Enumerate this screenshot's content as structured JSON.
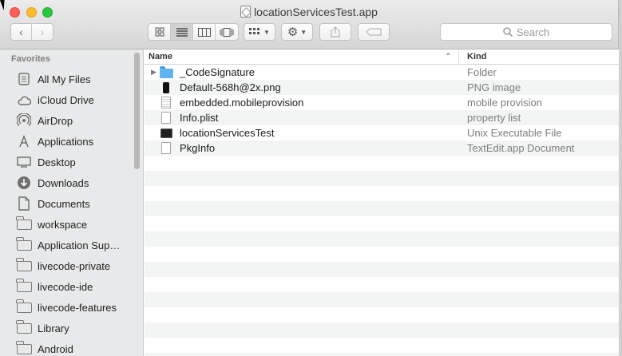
{
  "window": {
    "title": "locationServicesTest.app"
  },
  "toolbar": {
    "search_placeholder": "Search",
    "view_modes": [
      "icon",
      "list",
      "column",
      "cover-flow"
    ],
    "active_view": "list"
  },
  "sidebar": {
    "section_title": "Favorites",
    "items": [
      {
        "label": "All My Files",
        "icon": "all-files-icon"
      },
      {
        "label": "iCloud Drive",
        "icon": "cloud-icon"
      },
      {
        "label": "AirDrop",
        "icon": "airdrop-icon"
      },
      {
        "label": "Applications",
        "icon": "applications-icon"
      },
      {
        "label": "Desktop",
        "icon": "desktop-icon"
      },
      {
        "label": "Downloads",
        "icon": "downloads-icon"
      },
      {
        "label": "Documents",
        "icon": "documents-icon"
      },
      {
        "label": "workspace",
        "icon": "folder-icon"
      },
      {
        "label": "Application Sup…",
        "icon": "folder-icon"
      },
      {
        "label": "livecode-private",
        "icon": "folder-icon"
      },
      {
        "label": "livecode-ide",
        "icon": "folder-icon"
      },
      {
        "label": "livecode-features",
        "icon": "folder-icon"
      },
      {
        "label": "Library",
        "icon": "folder-icon"
      },
      {
        "label": "Android",
        "icon": "folder-icon"
      }
    ]
  },
  "file_list": {
    "columns": {
      "name": "Name",
      "kind": "Kind"
    },
    "rows": [
      {
        "name": "_CodeSignature",
        "kind": "Folder",
        "icon": "folder-icon",
        "expandable": true
      },
      {
        "name": "Default-568h@2x.png",
        "kind": "PNG image",
        "icon": "png-image-icon"
      },
      {
        "name": "embedded.mobileprovision",
        "kind": "mobile provision",
        "icon": "provision-file-icon"
      },
      {
        "name": "Info.plist",
        "kind": "property list",
        "icon": "plist-file-icon"
      },
      {
        "name": "locationServicesTest",
        "kind": "Unix Executable File",
        "icon": "executable-icon"
      },
      {
        "name": "PkgInfo",
        "kind": "TextEdit.app Document",
        "icon": "text-document-icon"
      }
    ]
  }
}
